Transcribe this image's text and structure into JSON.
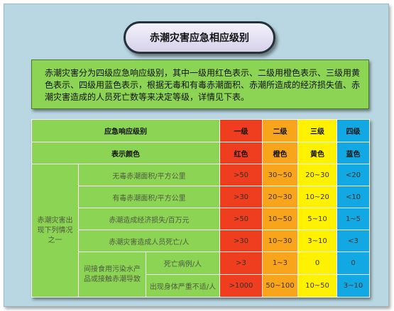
{
  "title": "赤潮灾害应急相应级别",
  "intro": "赤潮灾害分为四级应急响应级别，其中一级用红色表示、二级用橙色表示、三级用黄色表示、四级用蓝色表示，根据无毒和有毒赤潮面积、赤潮所造成的经济损失值、赤潮灾害造成的人员死亡数等来决定等级，详情见下表。",
  "table": {
    "header_label": "应急响应级别",
    "levels": [
      "一级",
      "二级",
      "三级",
      "四级"
    ],
    "color_row_label": "表示颜色",
    "colors": [
      "红色",
      "橙色",
      "黄色",
      "蓝色"
    ],
    "group_label": "赤潮灾害出现下列情况之一",
    "subgroup_label": "间接食用污染水产品或接触赤潮导致",
    "rows": [
      {
        "label": "无毒赤潮面积/平方公里",
        "values": [
          ">50",
          "30~50",
          "20~30",
          "<20"
        ]
      },
      {
        "label": "有毒赤潮面积/平方公里",
        "values": [
          ">30",
          "20~30",
          "10~20",
          "<10"
        ]
      },
      {
        "label": "赤潮造成经济损失/百万元",
        "values": [
          ">50",
          "10~50",
          "5~10",
          "1~5"
        ]
      },
      {
        "label": "赤潮灾害造成人员死亡/人",
        "values": [
          ">30",
          "10~30",
          "3~10",
          "<3"
        ]
      },
      {
        "label": "死亡病例/人",
        "values": [
          ">3",
          "1~3",
          "0",
          "0"
        ]
      },
      {
        "label": "出现身体严重不适/人",
        "values": [
          ">1000",
          "50~100",
          "10~50",
          "3~10"
        ]
      }
    ]
  },
  "colors": {
    "frame_bg": "#b9d7e3",
    "green": "#8cd454",
    "red": "#ef3d1f",
    "orange": "#f8a51c",
    "yellow": "#fff200",
    "blue": "#12a8e3"
  }
}
